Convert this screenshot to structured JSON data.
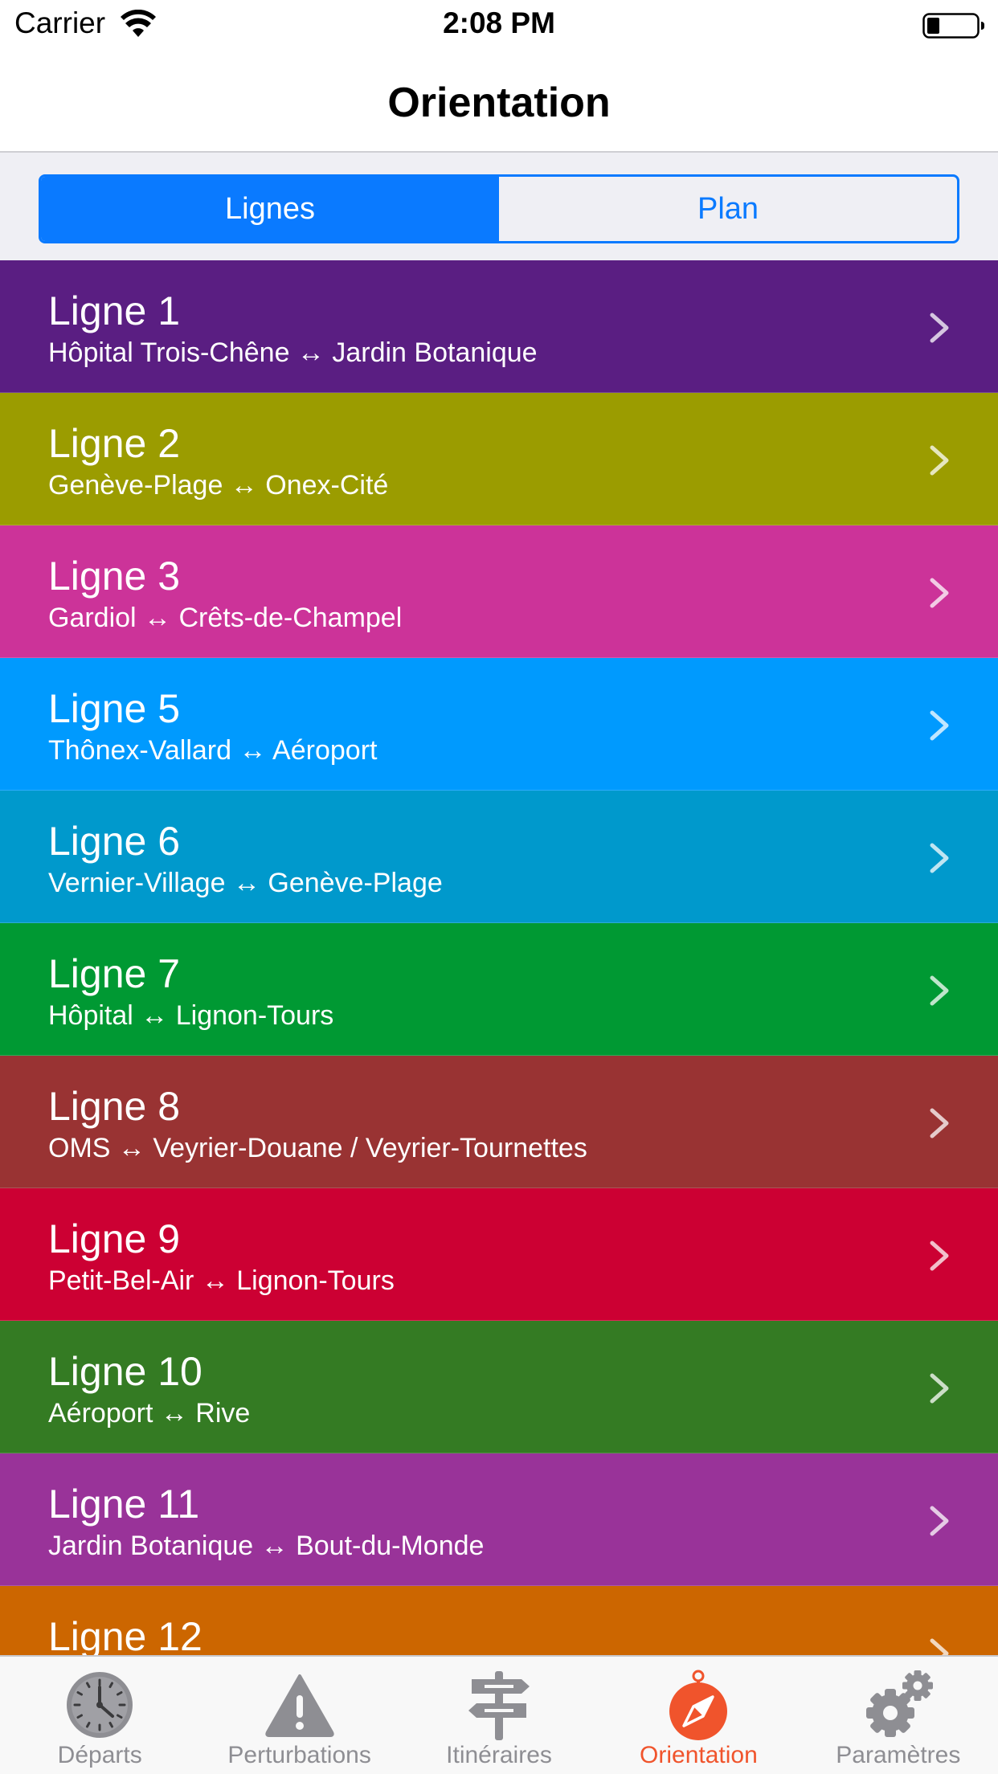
{
  "status_bar": {
    "carrier": "Carrier",
    "time": "2:08 PM"
  },
  "nav": {
    "title": "Orientation"
  },
  "segments": [
    {
      "label": "Lignes",
      "selected": true
    },
    {
      "label": "Plan",
      "selected": false
    }
  ],
  "lines": [
    {
      "name": "Ligne 1",
      "route": "Hôpital Trois-Chêne ↔ Jardin Botanique",
      "color": "#5a1e82"
    },
    {
      "name": "Ligne 2",
      "route": "Genève-Plage ↔ Onex-Cité",
      "color": "#9b9c00"
    },
    {
      "name": "Ligne 3",
      "route": "Gardiol ↔ Crêts-de-Champel",
      "color": "#cc3399"
    },
    {
      "name": "Ligne 5",
      "route": "Thônex-Vallard ↔ Aéroport",
      "color": "#009afe"
    },
    {
      "name": "Ligne 6",
      "route": "Vernier-Village ↔ Genève-Plage",
      "color": "#0099cc"
    },
    {
      "name": "Ligne 7",
      "route": "Hôpital ↔ Lignon-Tours",
      "color": "#009933"
    },
    {
      "name": "Ligne 8",
      "route": "OMS ↔ Veyrier-Douane / Veyrier-Tournettes",
      "color": "#993333"
    },
    {
      "name": "Ligne 9",
      "route": "Petit-Bel-Air ↔ Lignon-Tours",
      "color": "#cc0033"
    },
    {
      "name": "Ligne 10",
      "route": "Aéroport ↔ Rive",
      "color": "#347b23"
    },
    {
      "name": "Ligne 11",
      "route": "Jardin Botanique ↔ Bout-du-Monde",
      "color": "#993399"
    },
    {
      "name": "Ligne 12",
      "route": "",
      "color": "#cc6600"
    }
  ],
  "tabs": [
    {
      "label": "Départs",
      "icon": "clock-icon",
      "active": false
    },
    {
      "label": "Perturbations",
      "icon": "warning-icon",
      "active": false
    },
    {
      "label": "Itinéraires",
      "icon": "signpost-icon",
      "active": false
    },
    {
      "label": "Orientation",
      "icon": "compass-icon",
      "active": true
    },
    {
      "label": "Paramètres",
      "icon": "gears-icon",
      "active": false
    }
  ],
  "colors": {
    "accent": "#0a7aff",
    "tab_active": "#f0542c",
    "tab_inactive": "#8e8e93"
  }
}
